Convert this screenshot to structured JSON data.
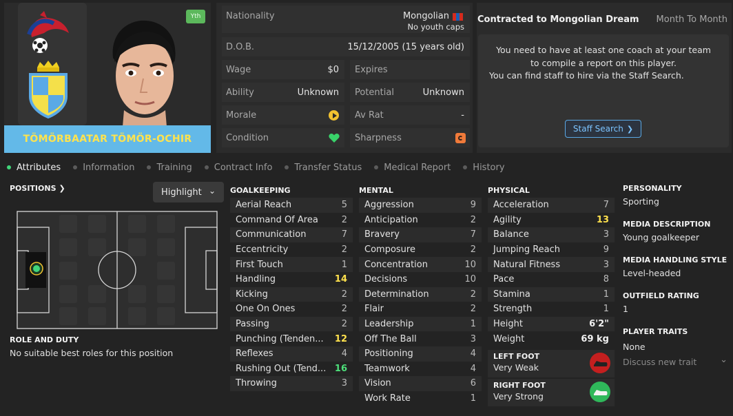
{
  "player": {
    "name": "TÖMÖRBAATAR TÖMÖR-OCHIR",
    "badge": "Yth"
  },
  "info": {
    "nationality_label": "Nationality",
    "nationality_value": "Mongolian",
    "caps": "No youth caps",
    "dob_label": "D.O.B.",
    "dob_value": "15/12/2005 (15 years old)",
    "wage_label": "Wage",
    "wage_value": "$0",
    "expires_label": "Expires",
    "expires_value": "",
    "ability_label": "Ability",
    "ability_value": "Unknown",
    "potential_label": "Potential",
    "potential_value": "Unknown",
    "morale_label": "Morale",
    "avrat_label": "Av Rat",
    "avrat_value": "-",
    "condition_label": "Condition",
    "sharpness_label": "Sharpness"
  },
  "contract": {
    "title": "Contracted to Mongolian Dream",
    "sub": "Month To Month",
    "msg1": "You need to have at least one coach at your team to compile a report on this player.",
    "msg2": "You can find staff to hire via the Staff Search.",
    "button": "Staff Search"
  },
  "tabs": [
    "Attributes",
    "Information",
    "Training",
    "Contract Info",
    "Transfer Status",
    "Medical Report",
    "History"
  ],
  "positions": {
    "title": "POSITIONS",
    "highlight": "Highlight",
    "role_title": "ROLE AND DUTY",
    "role_text": "No suitable best roles for this position"
  },
  "goalkeeping": {
    "title": "GOALKEEPING",
    "items": [
      {
        "name": "Aerial Reach",
        "value": "5"
      },
      {
        "name": "Command Of Area",
        "value": "2"
      },
      {
        "name": "Communication",
        "value": "7"
      },
      {
        "name": "Eccentricity",
        "value": "2"
      },
      {
        "name": "First Touch",
        "value": "1"
      },
      {
        "name": "Handling",
        "value": "14"
      },
      {
        "name": "Kicking",
        "value": "2"
      },
      {
        "name": "One On Ones",
        "value": "2"
      },
      {
        "name": "Passing",
        "value": "2"
      },
      {
        "name": "Punching (Tenden...",
        "value": "12"
      },
      {
        "name": "Reflexes",
        "value": "4"
      },
      {
        "name": "Rushing Out (Tend...",
        "value": "16"
      },
      {
        "name": "Throwing",
        "value": "3"
      }
    ]
  },
  "mental": {
    "title": "MENTAL",
    "items": [
      {
        "name": "Aggression",
        "value": "9"
      },
      {
        "name": "Anticipation",
        "value": "2"
      },
      {
        "name": "Bravery",
        "value": "7"
      },
      {
        "name": "Composure",
        "value": "2"
      },
      {
        "name": "Concentration",
        "value": "10"
      },
      {
        "name": "Decisions",
        "value": "10"
      },
      {
        "name": "Determination",
        "value": "2"
      },
      {
        "name": "Flair",
        "value": "2"
      },
      {
        "name": "Leadership",
        "value": "1"
      },
      {
        "name": "Off The Ball",
        "value": "3"
      },
      {
        "name": "Positioning",
        "value": "4"
      },
      {
        "name": "Teamwork",
        "value": "4"
      },
      {
        "name": "Vision",
        "value": "6"
      },
      {
        "name": "Work Rate",
        "value": "1"
      }
    ]
  },
  "physical": {
    "title": "PHYSICAL",
    "items": [
      {
        "name": "Acceleration",
        "value": "7"
      },
      {
        "name": "Agility",
        "value": "13"
      },
      {
        "name": "Balance",
        "value": "3"
      },
      {
        "name": "Jumping Reach",
        "value": "9"
      },
      {
        "name": "Natural Fitness",
        "value": "3"
      },
      {
        "name": "Pace",
        "value": "8"
      },
      {
        "name": "Stamina",
        "value": "1"
      },
      {
        "name": "Strength",
        "value": "1"
      },
      {
        "name": "Height",
        "value": "6'2\""
      },
      {
        "name": "Weight",
        "value": "69 kg"
      }
    ],
    "left_foot_label": "LEFT FOOT",
    "left_foot_value": "Very Weak",
    "right_foot_label": "RIGHT FOOT",
    "right_foot_value": "Very Strong"
  },
  "personality": {
    "personality_label": "PERSONALITY",
    "personality_value": "Sporting",
    "media_desc_label": "MEDIA DESCRIPTION",
    "media_desc_value": "Young goalkeeper",
    "media_style_label": "MEDIA HANDLING STYLE",
    "media_style_value": "Level-headed",
    "outfield_label": "OUTFIELD RATING",
    "outfield_value": "1",
    "traits_label": "PLAYER TRAITS",
    "traits_value": "None",
    "discuss": "Discuss new trait"
  },
  "colors": {
    "name_band": "#63b9e8",
    "name_text": "#ffe34d",
    "high_value": "#ffe14d",
    "very_high_value": "#4de07a",
    "active_tab_dot": "#41d67a"
  }
}
